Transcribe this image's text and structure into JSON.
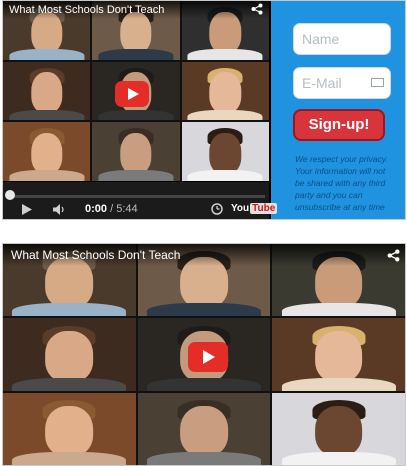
{
  "video": {
    "title": "What Most Schools Don't Teach",
    "time_current": "0:00",
    "time_total": "5:44",
    "progress_fraction": 0.0,
    "logo_you": "You",
    "logo_tube": "Tube"
  },
  "signup_form": {
    "name_placeholder": "Name",
    "email_placeholder": "E-Mail",
    "button_label": "Sign-up!",
    "privacy_text": "We respect your privacy. Your information will not be shared with any third party and you can unsubscribe at any time"
  },
  "icons": {
    "share": "share-icon",
    "play": "play-icon",
    "volume": "volume-icon",
    "settings": "clock-icon",
    "mail": "envelope-icon"
  },
  "colors": {
    "form_bg": "#1f92e0",
    "signup_button": "#d8343c",
    "play_button": "#e52d27"
  }
}
